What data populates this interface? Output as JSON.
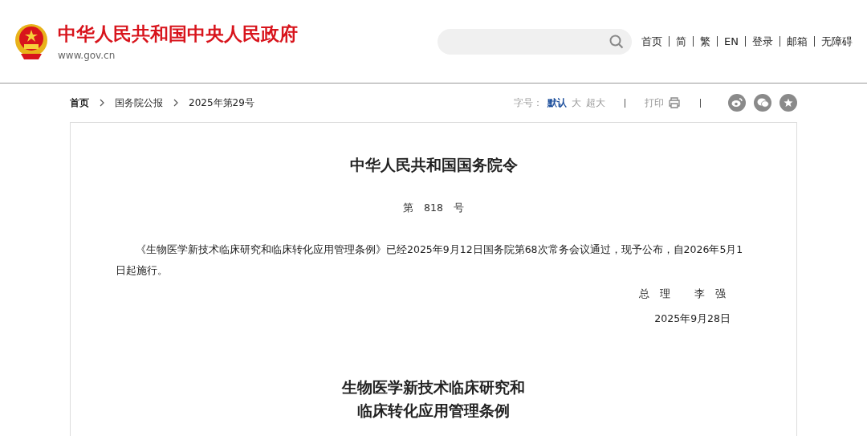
{
  "header": {
    "site_title": "中华人民共和国中央人民政府",
    "site_url": "www.gov.cn",
    "nav": [
      "首页",
      "简",
      "繁",
      "EN",
      "登录",
      "邮箱",
      "无障碍"
    ]
  },
  "breadcrumb": [
    "首页",
    "国务院公报",
    "2025年第29号"
  ],
  "tools": {
    "font_label": "字号：",
    "font_sizes": [
      {
        "label": "默认",
        "selected": true
      },
      {
        "label": "大",
        "selected": false
      },
      {
        "label": "超大",
        "selected": false
      }
    ],
    "print": "打印"
  },
  "article": {
    "title": "中华人民共和国国务院令",
    "number": "第　818　号",
    "paragraph_lines": [
      "《生物医学新技术临床研究和临床转化应用管理条例》已经2025年9月12日国务院第68次常务会议通过，现予公布，自2026年5月1",
      "日起施行。"
    ],
    "signer_title": "总　理",
    "signer_name": "李　强",
    "date": "2025年9月28日",
    "subtitle_lines": [
      "生物医学新技术临床研究和",
      "临床转化应用管理条例"
    ]
  }
}
